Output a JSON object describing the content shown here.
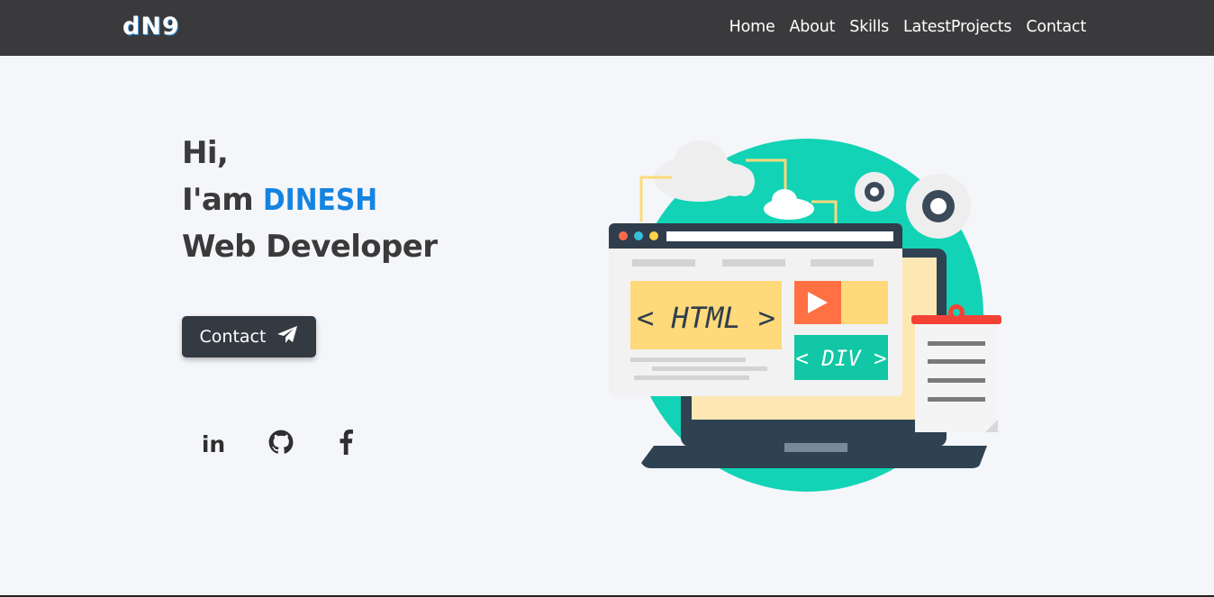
{
  "nav": {
    "logo": "dN9",
    "links": [
      "Home",
      "About",
      "Skills",
      "LatestProjects",
      "Contact"
    ]
  },
  "hero": {
    "greeting": "Hi,",
    "intro": "I'am ",
    "name": "DINESH",
    "role": "Web Developer",
    "contact_button": "Contact"
  },
  "illustration": {
    "html_tag": "< HTML >",
    "div_tag": "< DIV >"
  },
  "social": {
    "linkedin": "in",
    "icons": [
      "linkedin-icon",
      "github-icon",
      "facebook-icon"
    ]
  },
  "colors": {
    "navbar": "#3a3a3c",
    "accent": "#1583e0",
    "button": "#343a42",
    "background": "#f4f6fa"
  }
}
